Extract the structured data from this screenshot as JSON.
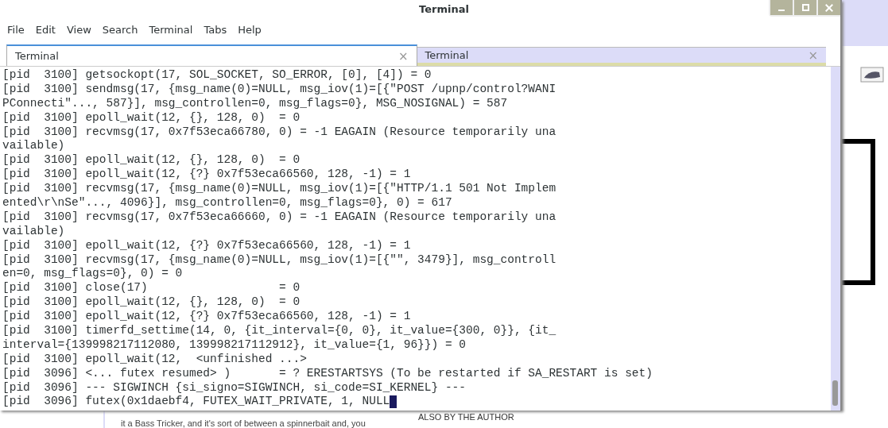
{
  "background_window": {
    "heading": "ALSO BY THE AUTHOR",
    "text": "it a Bass Tricker, and it's sort of between a spinnerbait and, you"
  },
  "window": {
    "title": "Terminal"
  },
  "menu": [
    "File",
    "Edit",
    "View",
    "Search",
    "Terminal",
    "Tabs",
    "Help"
  ],
  "tabs": [
    {
      "label": "Terminal",
      "selected": true,
      "close": "×"
    },
    {
      "label": "Terminal",
      "selected": false,
      "close": "×"
    }
  ],
  "terminal": {
    "cursor": true,
    "lines": [
      "[pid  3100] getsockopt(17, SOL_SOCKET, SO_ERROR, [0], [4]) = 0",
      "[pid  3100] sendmsg(17, {msg_name(0)=NULL, msg_iov(1)=[{\"POST /upnp/control?WANI",
      "PConnecti\"..., 587}], msg_controllen=0, msg_flags=0}, MSG_NOSIGNAL) = 587",
      "[pid  3100] epoll_wait(12, {}, 128, 0)  = 0",
      "[pid  3100] recvmsg(17, 0x7f53eca66780, 0) = -1 EAGAIN (Resource temporarily una",
      "vailable)",
      "[pid  3100] epoll_wait(12, {}, 128, 0)  = 0",
      "[pid  3100] epoll_wait(12, {?} 0x7f53eca66560, 128, -1) = 1",
      "[pid  3100] recvmsg(17, {msg_name(0)=NULL, msg_iov(1)=[{\"HTTP/1.1 501 Not Implem",
      "ented\\r\\nSe\"..., 4096}], msg_controllen=0, msg_flags=0}, 0) = 617",
      "[pid  3100] recvmsg(17, 0x7f53eca66660, 0) = -1 EAGAIN (Resource temporarily una",
      "vailable)",
      "[pid  3100] epoll_wait(12, {?} 0x7f53eca66560, 128, -1) = 1",
      "[pid  3100] recvmsg(17, {msg_name(0)=NULL, msg_iov(1)=[{\"\", 3479}], msg_controll",
      "en=0, msg_flags=0}, 0) = 0",
      "[pid  3100] close(17)                   = 0",
      "[pid  3100] epoll_wait(12, {}, 128, 0)  = 0",
      "[pid  3100] epoll_wait(12, {?} 0x7f53eca66560, 128, -1) = 1",
      "[pid  3100] timerfd_settime(14, 0, {it_interval={0, 0}, it_value={300, 0}}, {it_",
      "interval={139998217112080, 139998217112912}, it_value={1, 96}}) = 0",
      "[pid  3100] epoll_wait(12,  <unfinished ...>",
      "[pid  3096] <... futex resumed> )       = ? ERESTARTSYS (To be restarted if SA_RESTART is set)",
      "[pid  3096] --- SIGWINCH {si_signo=SIGWINCH, si_code=SI_KERNEL} ---",
      "[pid  3096] futex(0x1daebf4, FUTEX_WAIT_PRIVATE, 1, NULL"
    ]
  }
}
